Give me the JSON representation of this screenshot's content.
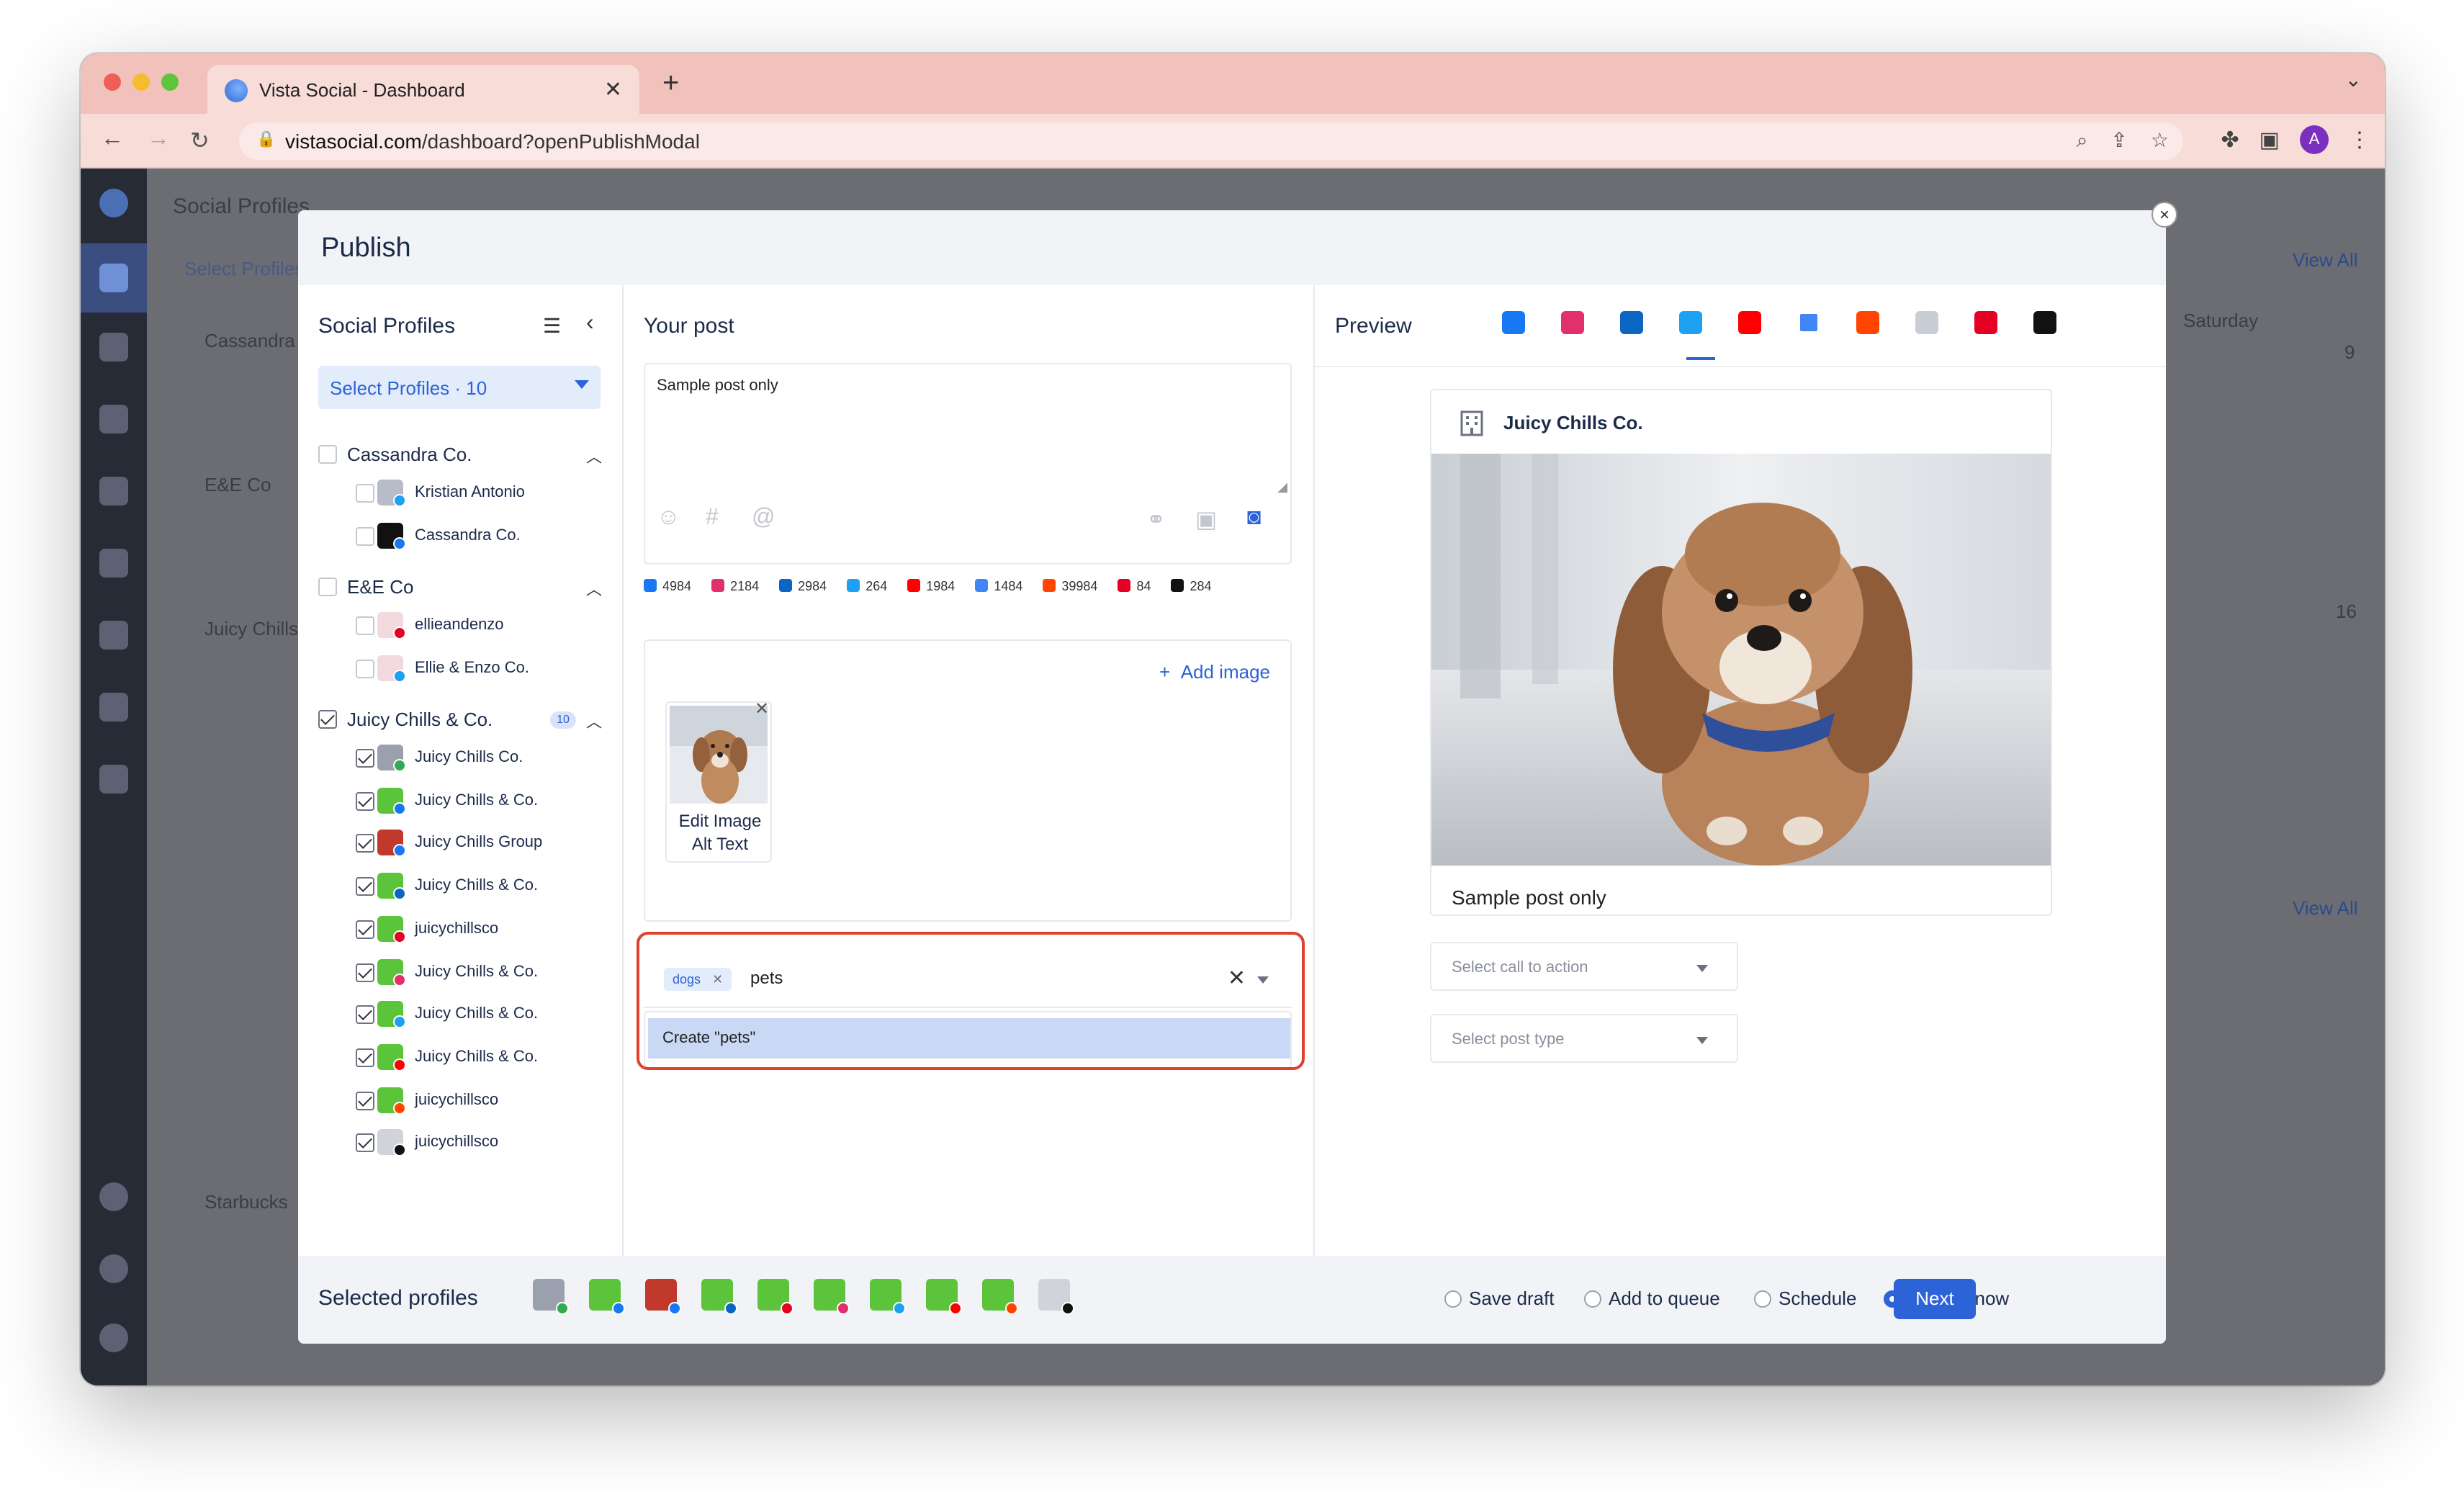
{
  "browser": {
    "tab_title": "Vista Social - Dashboard",
    "url_domain": "vistasocial.com",
    "url_path": "/dashboard?openPublishModal",
    "avatar_letter": "A"
  },
  "background": {
    "social_profiles_label": "Social Profiles",
    "select_profiles": "Select Profiles",
    "groups": [
      "Cassandra",
      "E&E Co",
      "Juicy Chills",
      "Starbucks"
    ],
    "view_all": "View All",
    "saturday": "Saturday",
    "day_9": "9",
    "day_16": "16"
  },
  "modal": {
    "title": "Publish",
    "close": "×"
  },
  "social_profiles": {
    "heading": "Social Profiles",
    "select_label": "Select Profiles · 10",
    "groups": [
      {
        "name": "Cassandra Co.",
        "checked": false,
        "profiles": [
          {
            "name": "Kristian Antonio",
            "checked": false,
            "avatar_color": "#b7bcc8",
            "network_color": "#1da1f2"
          },
          {
            "name": "Cassandra Co.",
            "checked": false,
            "avatar_color": "#111111",
            "network_color": "#1877f2"
          }
        ]
      },
      {
        "name": "E&E Co",
        "checked": false,
        "profiles": [
          {
            "name": "ellieandenzo",
            "checked": false,
            "avatar_color": "#f1d9dd",
            "network_color": "#e60023"
          },
          {
            "name": "Ellie & Enzo Co.",
            "checked": false,
            "avatar_color": "#f1d9dd",
            "network_color": "#1da1f2"
          }
        ]
      },
      {
        "name": "Juicy Chills & Co.",
        "checked": true,
        "count": "10",
        "profiles": [
          {
            "name": "Juicy Chills Co.",
            "checked": true,
            "avatar_color": "#9aa0ad",
            "network_color": "#34a853"
          },
          {
            "name": "Juicy Chills & Co.",
            "checked": true,
            "avatar_color": "#5cc43a",
            "network_color": "#1877f2"
          },
          {
            "name": "Juicy Chills Group",
            "checked": true,
            "avatar_color": "#c0392b",
            "network_color": "#1877f2"
          },
          {
            "name": "Juicy Chills & Co.",
            "checked": true,
            "avatar_color": "#5cc43a",
            "network_color": "#0a66c2"
          },
          {
            "name": "juicychillsco",
            "checked": true,
            "avatar_color": "#5cc43a",
            "network_color": "#e60023"
          },
          {
            "name": "Juicy Chills & Co.",
            "checked": true,
            "avatar_color": "#5cc43a",
            "network_color": "#e1306c"
          },
          {
            "name": "Juicy Chills & Co.",
            "checked": true,
            "avatar_color": "#5cc43a",
            "network_color": "#1da1f2"
          },
          {
            "name": "Juicy Chills & Co.",
            "checked": true,
            "avatar_color": "#5cc43a",
            "network_color": "#ff0000"
          },
          {
            "name": "juicychillsco",
            "checked": true,
            "avatar_color": "#5cc43a",
            "network_color": "#ff4500"
          },
          {
            "name": "juicychillsco",
            "checked": true,
            "avatar_color": "#d0d3da",
            "network_color": "#111111"
          }
        ]
      }
    ]
  },
  "your_post": {
    "heading": "Your post",
    "text": "Sample post only",
    "counts": [
      {
        "network": "facebook",
        "value": "4984",
        "color": "#1877f2"
      },
      {
        "network": "instagram",
        "value": "2184",
        "color": "#e1306c"
      },
      {
        "network": "linkedin",
        "value": "2984",
        "color": "#0a66c2"
      },
      {
        "network": "twitter",
        "value": "264",
        "color": "#1da1f2"
      },
      {
        "network": "youtube",
        "value": "1984",
        "color": "#ff0000"
      },
      {
        "network": "google",
        "value": "1484",
        "color": "#4285f4"
      },
      {
        "network": "reddit",
        "value": "39984",
        "color": "#ff4500"
      },
      {
        "network": "pinterest",
        "value": "84",
        "color": "#e60023"
      },
      {
        "network": "tiktok",
        "value": "284",
        "color": "#111111"
      }
    ],
    "add_image": "Add image",
    "edit_alt_line1": "Edit Image",
    "edit_alt_line2": "Alt Text",
    "tag_chip": "dogs",
    "tag_input": "pets",
    "create_option": "Create \"pets\""
  },
  "preview": {
    "heading": "Preview",
    "active_network": "google",
    "networks": [
      {
        "name": "facebook",
        "color": "#1877f2"
      },
      {
        "name": "instagram",
        "color": "#e1306c"
      },
      {
        "name": "linkedin",
        "color": "#0a66c2"
      },
      {
        "name": "twitter",
        "color": "#1da1f2"
      },
      {
        "name": "youtube",
        "color": "#ff0000"
      },
      {
        "name": "google",
        "color": "#4285f4"
      },
      {
        "name": "reddit",
        "color": "#ff4500"
      },
      {
        "name": "vimeo",
        "color": "#c9cdd6"
      },
      {
        "name": "pinterest",
        "color": "#e60023"
      },
      {
        "name": "tiktok",
        "color": "#111111"
      }
    ],
    "profile_name": "Juicy Chills Co.",
    "caption": "Sample post only",
    "call_to_action_placeholder": "Select call to action",
    "post_type_placeholder": "Select post type"
  },
  "footer": {
    "selected_profiles": "Selected profiles",
    "options": [
      {
        "label": "Save draft",
        "selected": false
      },
      {
        "label": "Add to queue",
        "selected": false
      },
      {
        "label": "Schedule",
        "selected": false
      },
      {
        "label": "Publish now",
        "selected": true
      }
    ],
    "next": "Next"
  },
  "colors": {
    "accent": "#2c63d6",
    "highlight_outline": "#e0412f",
    "tabbar": "#f0c2bb"
  }
}
